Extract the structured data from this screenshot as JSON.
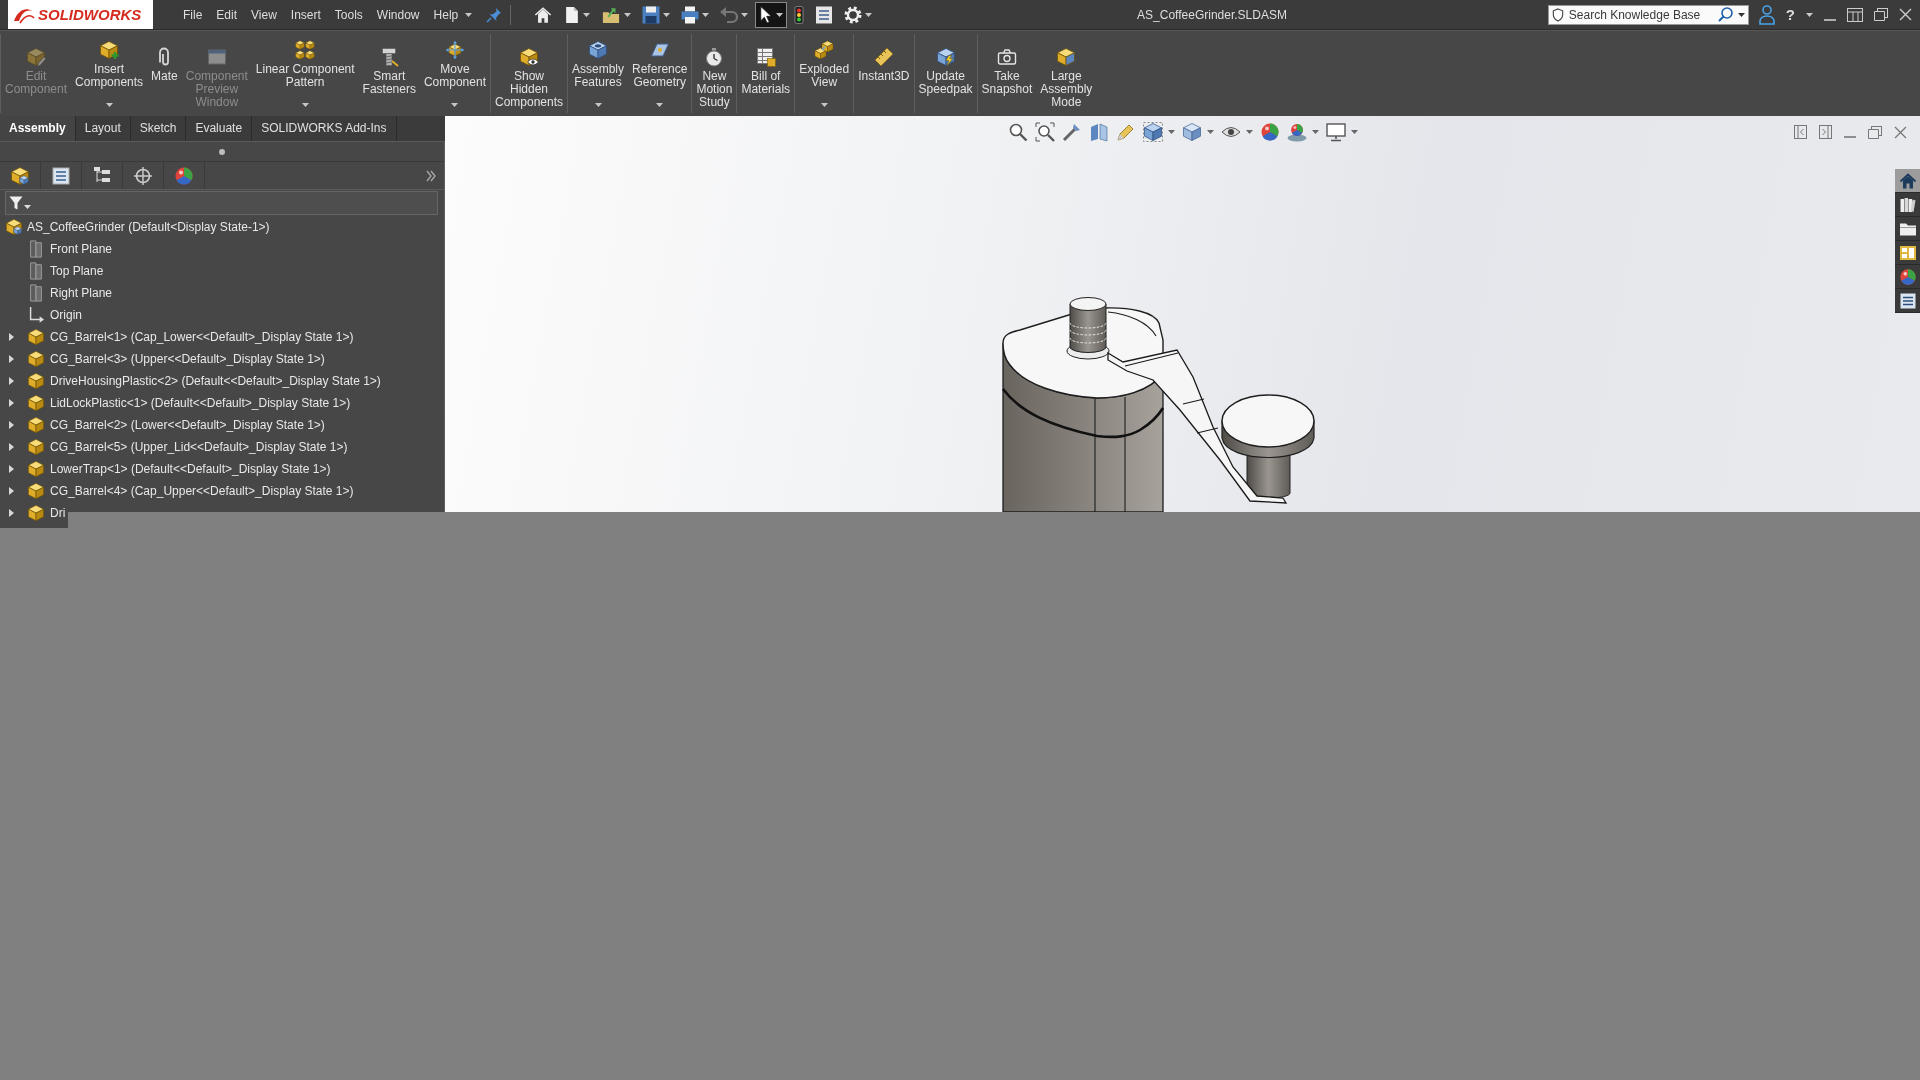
{
  "titlebar": {
    "logo": "SOLIDWORKS",
    "menu": [
      "File",
      "Edit",
      "View",
      "Insert",
      "Tools",
      "Window",
      "Help"
    ],
    "title": "AS_CoffeeGrinder.SLDASM",
    "search": {
      "placeholder": "Search Knowledge Base"
    },
    "help": "?"
  },
  "quick_access": [
    {
      "kind": "home",
      "dropdown": false,
      "disabled": false,
      "selected": false
    },
    {
      "kind": "new",
      "dropdown": true,
      "disabled": false,
      "selected": false
    },
    {
      "kind": "open",
      "dropdown": true,
      "disabled": false,
      "selected": false
    },
    {
      "kind": "save",
      "dropdown": true,
      "disabled": false,
      "selected": false
    },
    {
      "kind": "print",
      "dropdown": true,
      "disabled": false,
      "selected": false
    },
    {
      "kind": "undo",
      "dropdown": true,
      "disabled": true,
      "selected": false
    },
    {
      "kind": "select",
      "dropdown": true,
      "disabled": false,
      "selected": true
    },
    {
      "kind": "rebuild",
      "dropdown": false,
      "disabled": false,
      "selected": false
    },
    {
      "kind": "properties",
      "dropdown": false,
      "disabled": false,
      "selected": false
    },
    {
      "kind": "options",
      "dropdown": true,
      "disabled": false,
      "selected": false
    }
  ],
  "ribbon": [
    {
      "buttons": [
        {
          "kind": "edit",
          "label": "Edit\nComponent",
          "disabled": true,
          "dropdown": false
        },
        {
          "kind": "insert",
          "label": "Insert\nComponents",
          "disabled": false,
          "dropdown": true
        },
        {
          "kind": "mate",
          "label": "Mate",
          "disabled": false,
          "dropdown": false
        },
        {
          "kind": "preview",
          "label": "Component\nPreview\nWindow",
          "disabled": true,
          "dropdown": false
        },
        {
          "kind": "pattern",
          "label": "Linear Component\nPattern",
          "disabled": false,
          "dropdown": true
        },
        {
          "kind": "fastener",
          "label": "Smart\nFasteners",
          "disabled": false,
          "dropdown": false
        },
        {
          "kind": "move",
          "label": "Move\nComponent",
          "disabled": false,
          "dropdown": true
        }
      ]
    },
    {
      "buttons": [
        {
          "kind": "show",
          "label": "Show\nHidden\nComponents",
          "disabled": false,
          "dropdown": false
        }
      ]
    },
    {
      "buttons": [
        {
          "kind": "feature",
          "label": "Assembly\nFeatures",
          "disabled": false,
          "dropdown": true
        },
        {
          "kind": "geometry",
          "label": "Reference\nGeometry",
          "disabled": false,
          "dropdown": true
        }
      ]
    },
    {
      "buttons": [
        {
          "kind": "motion",
          "label": "New\nMotion\nStudy",
          "disabled": false,
          "dropdown": false
        }
      ]
    },
    {
      "buttons": [
        {
          "kind": "bom",
          "label": "Bill of\nMaterials",
          "disabled": false,
          "dropdown": false
        }
      ]
    },
    {
      "buttons": [
        {
          "kind": "explode",
          "label": "Exploded\nView",
          "disabled": false,
          "dropdown": true
        }
      ]
    },
    {
      "buttons": [
        {
          "kind": "instant3d",
          "label": "Instant3D",
          "disabled": false,
          "dropdown": false
        }
      ]
    },
    {
      "buttons": [
        {
          "kind": "speedpak",
          "label": "Update\nSpeedpak",
          "disabled": false,
          "dropdown": false
        }
      ]
    },
    {
      "buttons": [
        {
          "kind": "snapshot",
          "label": "Take\nSnapshot",
          "disabled": false,
          "dropdown": false
        },
        {
          "kind": "large",
          "label": "Large\nAssembly\nMode",
          "disabled": false,
          "dropdown": false
        }
      ]
    }
  ],
  "tabs": [
    {
      "label": "Assembly",
      "selected": true
    },
    {
      "label": "Layout",
      "selected": false
    },
    {
      "label": "Sketch",
      "selected": false
    },
    {
      "label": "Evaluate",
      "selected": false
    },
    {
      "label": "SOLIDWORKS Add-Ins",
      "selected": false
    }
  ],
  "feature_tree": {
    "label": "AS_CoffeeGrinder (Default<Display State-1>)",
    "children": [
      {
        "kind": "plane",
        "label": "Front Plane"
      },
      {
        "kind": "plane",
        "label": "Top Plane"
      },
      {
        "kind": "plane",
        "label": "Right Plane"
      },
      {
        "kind": "origin",
        "label": "Origin"
      },
      {
        "kind": "component",
        "label": "CG_Barrel<1> (Cap_Lower<<Default>_Display State 1>)",
        "expanded": false
      },
      {
        "kind": "component",
        "label": "CG_Barrel<3> (Upper<<Default>_Display State 1>)",
        "expanded": false
      },
      {
        "kind": "component",
        "label": "DriveHousingPlastic<2> (Default<<Default>_Display State 1>)",
        "expanded": false
      },
      {
        "kind": "component",
        "label": "LidLockPlastic<1> (Default<<Default>_Display State 1>)",
        "expanded": false
      },
      {
        "kind": "component",
        "label": "CG_Barrel<2> (Lower<<Default>_Display State 1>)",
        "expanded": false
      },
      {
        "kind": "component",
        "label": "CG_Barrel<5> (Upper_Lid<<Default>_Display State 1>)",
        "expanded": false
      },
      {
        "kind": "component",
        "label": "LowerTrap<1> (Default<<Default>_Display State 1>)",
        "expanded": false
      },
      {
        "kind": "component",
        "label": "CG_Barrel<4> (Cap_Upper<<Default>_Display State 1>)",
        "expanded": false
      },
      {
        "kind": "component",
        "label": "Dri",
        "expanded": false
      }
    ]
  },
  "task_pane": [
    {
      "kind": "home",
      "selected": true
    },
    {
      "kind": "library",
      "selected": false
    },
    {
      "kind": "explorer",
      "selected": false
    },
    {
      "kind": "palette",
      "selected": false
    },
    {
      "kind": "appearance",
      "selected": false
    },
    {
      "kind": "properties",
      "selected": false
    }
  ]
}
